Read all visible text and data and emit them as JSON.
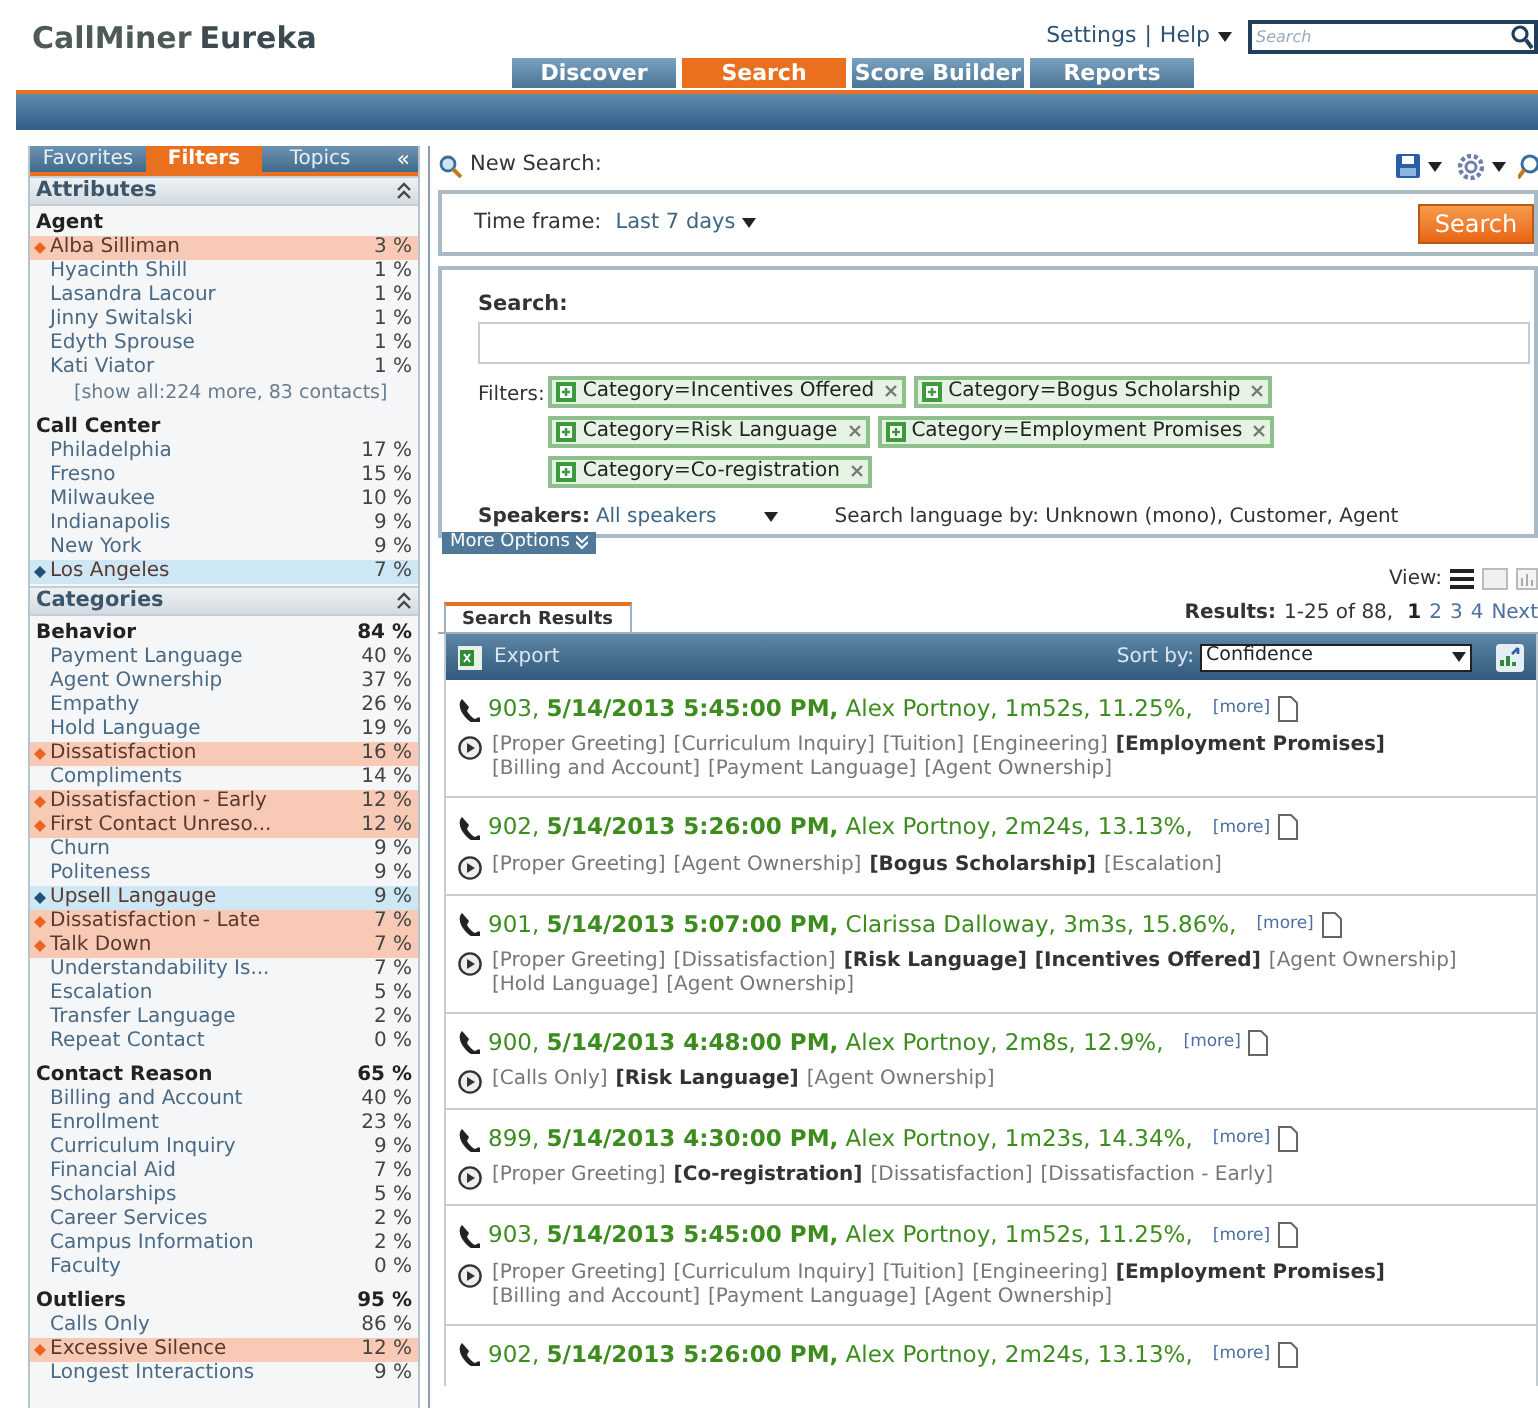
{
  "header": {
    "brand": "CallMiner",
    "product": "Eureka",
    "links": [
      "Settings",
      "Help"
    ],
    "separator": "|",
    "search_placeholder": "Search"
  },
  "nav_tabs": [
    {
      "label": "Discover",
      "selected": false
    },
    {
      "label": "Search",
      "selected": true
    },
    {
      "label": "Score Builder",
      "selected": false
    },
    {
      "label": "Reports",
      "selected": false
    }
  ],
  "sidebar": {
    "tabs": [
      {
        "label": "Favorites",
        "selected": false
      },
      {
        "label": "Filters",
        "selected": true
      },
      {
        "label": "Topics",
        "selected": false
      }
    ],
    "collapse": "«",
    "sections": [
      {
        "title": "Attributes",
        "groups": [
          {
            "title": "Agent",
            "items": [
              {
                "label": "Alba Silliman",
                "value": "3 %",
                "kind": "include"
              },
              {
                "label": "Hyacinth Shill",
                "value": "1 %",
                "kind": "plain"
              },
              {
                "label": "Lasandra Lacour",
                "value": "1 %",
                "kind": "plain"
              },
              {
                "label": "Jinny Switalski",
                "value": "1 %",
                "kind": "plain"
              },
              {
                "label": "Edyth Sprouse",
                "value": "1 %",
                "kind": "plain"
              },
              {
                "label": "Kati Viator",
                "value": "1 %",
                "kind": "plain"
              }
            ],
            "more": "[show all:224 more, 83 contacts]"
          },
          {
            "title": "Call Center",
            "items": [
              {
                "label": "Philadelphia",
                "value": "17 %",
                "kind": "plain"
              },
              {
                "label": "Fresno",
                "value": "15 %",
                "kind": "plain"
              },
              {
                "label": "Milwaukee",
                "value": "10 %",
                "kind": "plain"
              },
              {
                "label": "Indianapolis",
                "value": "9 %",
                "kind": "plain"
              },
              {
                "label": "New York",
                "value": "9 %",
                "kind": "plain"
              },
              {
                "label": "Los Angeles",
                "value": "7 %",
                "kind": "exclude"
              }
            ]
          }
        ]
      },
      {
        "title": "Categories",
        "groups": [
          {
            "title": "Behavior",
            "value": "84 %",
            "items": [
              {
                "label": "Payment Language",
                "value": "40 %",
                "kind": "plain"
              },
              {
                "label": "Agent Ownership",
                "value": "37 %",
                "kind": "plain"
              },
              {
                "label": "Empathy",
                "value": "26 %",
                "kind": "plain"
              },
              {
                "label": "Hold Language",
                "value": "19 %",
                "kind": "plain"
              },
              {
                "label": "Dissatisfaction",
                "value": "16 %",
                "kind": "include"
              },
              {
                "label": "Compliments",
                "value": "14 %",
                "kind": "plain"
              },
              {
                "label": "Dissatisfaction - Early",
                "value": "12 %",
                "kind": "include"
              },
              {
                "label": "First Contact Unreso...",
                "value": "12 %",
                "kind": "include"
              },
              {
                "label": "Churn",
                "value": "9 %",
                "kind": "plain"
              },
              {
                "label": "Politeness",
                "value": "9 %",
                "kind": "plain"
              },
              {
                "label": "Upsell Langauge",
                "value": "9 %",
                "kind": "exclude"
              },
              {
                "label": "Dissatisfaction - Late",
                "value": "7 %",
                "kind": "include"
              },
              {
                "label": "Talk Down",
                "value": "7 %",
                "kind": "include"
              },
              {
                "label": "Understandability Is...",
                "value": "7 %",
                "kind": "plain"
              },
              {
                "label": "Escalation",
                "value": "5 %",
                "kind": "plain"
              },
              {
                "label": "Transfer Language",
                "value": "2 %",
                "kind": "plain"
              },
              {
                "label": "Repeat Contact",
                "value": "0 %",
                "kind": "plain"
              }
            ]
          },
          {
            "title": "Contact Reason",
            "value": "65 %",
            "items": [
              {
                "label": "Billing and Account",
                "value": "40 %",
                "kind": "plain"
              },
              {
                "label": "Enrollment",
                "value": "23 %",
                "kind": "plain"
              },
              {
                "label": "Curriculum Inquiry",
                "value": "9 %",
                "kind": "plain"
              },
              {
                "label": "Financial Aid",
                "value": "7 %",
                "kind": "plain"
              },
              {
                "label": "Scholarships",
                "value": "5 %",
                "kind": "plain"
              },
              {
                "label": "Career Services",
                "value": "2 %",
                "kind": "plain"
              },
              {
                "label": "Campus Information",
                "value": "2 %",
                "kind": "plain"
              },
              {
                "label": "Faculty",
                "value": "0 %",
                "kind": "plain"
              }
            ]
          },
          {
            "title": "Outliers",
            "value": "95 %",
            "items": [
              {
                "label": "Calls Only",
                "value": "86 %",
                "kind": "plain"
              },
              {
                "label": "Excessive Silence",
                "value": "12 %",
                "kind": "include"
              },
              {
                "label": "Longest Interactions",
                "value": "9 %",
                "kind": "plain"
              }
            ]
          }
        ]
      }
    ]
  },
  "search_panel": {
    "title": "New Search:",
    "time_frame_label": "Time frame:",
    "time_frame": "Last 7 days",
    "search_button": "Search",
    "search_label": "Search:",
    "filters_label": "Filters:",
    "filters": [
      "Category=Incentives Offered",
      "Category=Bogus Scholarship",
      "Category=Risk Language",
      "Category=Employment Promises",
      "Category=Co-registration"
    ],
    "speakers_label": "Speakers:",
    "speakers": "All speakers",
    "language": "Search language by: Unknown (mono), Customer, Agent",
    "more_options": "More Options"
  },
  "results": {
    "view_label": "View:",
    "tab": "Search Results",
    "summary_label": "Results:",
    "summary": "1-25 of 88,",
    "pages": [
      {
        "label": "1",
        "selected": true
      },
      {
        "label": "2",
        "selected": false
      },
      {
        "label": "3",
        "selected": false
      },
      {
        "label": "4",
        "selected": false
      }
    ],
    "next": "Next",
    "export": "Export",
    "sort_label": "Sort by:",
    "sort": "Confidence",
    "items": [
      {
        "heading": "903, **5/14/2013 5:45:00 PM,** Alex Portnoy, 1m52s, 11.25%,",
        "more": "[more]",
        "tags": [
          {
            "label": "[Proper Greeting]",
            "matched": false
          },
          {
            "label": "[Curriculum Inquiry]",
            "matched": false
          },
          {
            "label": "[Tuition]",
            "matched": false
          },
          {
            "label": "[Engineering]",
            "matched": false
          },
          {
            "label": "[Employment Promises]",
            "matched": true
          },
          {
            "label": "[Billing and Account]",
            "matched": false
          },
          {
            "label": "[Payment Language]",
            "matched": false
          },
          {
            "label": "[Agent Ownership]",
            "matched": false
          }
        ]
      },
      {
        "heading": "902, **5/14/2013 5:26:00 PM,** Alex Portnoy, 2m24s, 13.13%,",
        "more": "[more]",
        "tags": [
          {
            "label": "[Proper Greeting]",
            "matched": false
          },
          {
            "label": "[Agent Ownership]",
            "matched": false
          },
          {
            "label": "[Bogus Scholarship]",
            "matched": true
          },
          {
            "label": "[Escalation]",
            "matched": false
          }
        ]
      },
      {
        "heading": "901, **5/14/2013 5:07:00 PM,** Clarissa Dalloway, 3m3s, 15.86%,",
        "more": "[more]",
        "tags": [
          {
            "label": "[Proper Greeting]",
            "matched": false
          },
          {
            "label": "[Dissatisfaction]",
            "matched": false
          },
          {
            "label": "[Risk Language]",
            "matched": true
          },
          {
            "label": "[Incentives Offered]",
            "matched": true
          },
          {
            "label": "[Agent Ownership]",
            "matched": false
          },
          {
            "label": "[Hold Language]",
            "matched": false
          },
          {
            "label": "[Agent Ownership]",
            "matched": false
          }
        ]
      },
      {
        "heading": "900, **5/14/2013 4:48:00 PM,** Alex Portnoy, 2m8s, 12.9%,",
        "more": "[more]",
        "tags": [
          {
            "label": "[Calls Only]",
            "matched": false
          },
          {
            "label": "[Risk Language]",
            "matched": true
          },
          {
            "label": "[Agent Ownership]",
            "matched": false
          }
        ]
      },
      {
        "heading": "899, **5/14/2013 4:30:00 PM,** Alex Portnoy, 1m23s, 14.34%,",
        "more": "[more]",
        "tags": [
          {
            "label": "[Proper Greeting]",
            "matched": false
          },
          {
            "label": "[Co-registration]",
            "matched": true
          },
          {
            "label": "[Dissatisfaction]",
            "matched": false
          },
          {
            "label": "[Dissatisfaction - Early]",
            "matched": false
          }
        ]
      },
      {
        "heading": "903, **5/14/2013 5:45:00 PM,** Alex Portnoy, 1m52s, 11.25%,",
        "more": "[more]",
        "tags": [
          {
            "label": "[Proper Greeting]",
            "matched": false
          },
          {
            "label": "[Curriculum Inquiry]",
            "matched": false
          },
          {
            "label": "[Tuition]",
            "matched": false
          },
          {
            "label": "[Engineering]",
            "matched": false
          },
          {
            "label": "[Employment Promises]",
            "matched": true
          },
          {
            "label": "[Billing and Account]",
            "matched": false
          },
          {
            "label": "[Payment Language]",
            "matched": false
          },
          {
            "label": "[Agent Ownership]",
            "matched": false
          }
        ]
      },
      {
        "heading": "902, **5/14/2013 5:26:00 PM,** Alex Portnoy, 2m24s, 13.13%,",
        "more": "[more]"
      }
    ]
  }
}
